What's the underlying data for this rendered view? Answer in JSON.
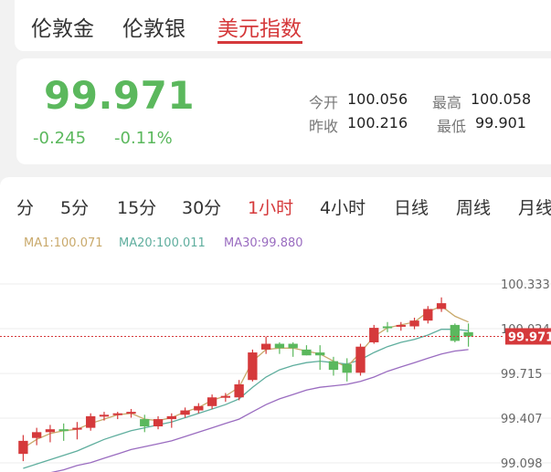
{
  "top_tabs": [
    {
      "label": "伦敦金",
      "active": false
    },
    {
      "label": "伦敦银",
      "active": false
    },
    {
      "label": "美元指数",
      "active": true
    }
  ],
  "quote": {
    "price": "99.971",
    "change": "-0.245",
    "change_pct": "-0.11%",
    "open_label": "今开",
    "open": "100.056",
    "prev_close_label": "昨收",
    "prev_close": "100.216",
    "high_label": "最高",
    "high": "100.058",
    "low_label": "最低",
    "low": "99.901",
    "up_color": "#d5393b",
    "down_color": "#5bb85d"
  },
  "periods": [
    {
      "label": "分",
      "active": false
    },
    {
      "label": "5分",
      "active": false
    },
    {
      "label": "15分",
      "active": false
    },
    {
      "label": "30分",
      "active": false
    },
    {
      "label": "1小时",
      "active": true
    },
    {
      "label": "4小时",
      "active": false
    },
    {
      "label": "日线",
      "active": false
    },
    {
      "label": "周线",
      "active": false
    },
    {
      "label": "月线",
      "active": false
    }
  ],
  "ma_legend": [
    {
      "label": "MA1:100.071",
      "color": "#c9a96b"
    },
    {
      "label": "MA20:100.011",
      "color": "#5fae9e"
    },
    {
      "label": "MA30:99.880",
      "color": "#9a6cc0"
    }
  ],
  "chart_data": {
    "type": "candlestick",
    "y_ticks": [
      "100.333",
      "100.024",
      "99.715",
      "99.407",
      "99.098"
    ],
    "ylim": [
      99.098,
      100.333
    ],
    "last_price_label": "99.971",
    "last_price": 99.971,
    "candles": [
      {
        "o": 99.16,
        "h": 99.29,
        "l": 99.11,
        "c": 99.25
      },
      {
        "o": 99.27,
        "h": 99.34,
        "l": 99.22,
        "c": 99.31
      },
      {
        "o": 99.31,
        "h": 99.36,
        "l": 99.24,
        "c": 99.33
      },
      {
        "o": 99.33,
        "h": 99.37,
        "l": 99.25,
        "c": 99.32
      },
      {
        "o": 99.33,
        "h": 99.38,
        "l": 99.26,
        "c": 99.34
      },
      {
        "o": 99.34,
        "h": 99.44,
        "l": 99.32,
        "c": 99.42
      },
      {
        "o": 99.42,
        "h": 99.45,
        "l": 99.39,
        "c": 99.43
      },
      {
        "o": 99.43,
        "h": 99.45,
        "l": 99.4,
        "c": 99.44
      },
      {
        "o": 99.44,
        "h": 99.47,
        "l": 99.41,
        "c": 99.45
      },
      {
        "o": 99.4,
        "h": 99.43,
        "l": 99.31,
        "c": 99.35
      },
      {
        "o": 99.35,
        "h": 99.42,
        "l": 99.33,
        "c": 99.4
      },
      {
        "o": 99.4,
        "h": 99.44,
        "l": 99.34,
        "c": 99.42
      },
      {
        "o": 99.43,
        "h": 99.48,
        "l": 99.41,
        "c": 99.46
      },
      {
        "o": 99.46,
        "h": 99.51,
        "l": 99.44,
        "c": 99.49
      },
      {
        "o": 99.49,
        "h": 99.57,
        "l": 99.47,
        "c": 99.55
      },
      {
        "o": 99.55,
        "h": 99.58,
        "l": 99.52,
        "c": 99.56
      },
      {
        "o": 99.55,
        "h": 99.67,
        "l": 99.53,
        "c": 99.64
      },
      {
        "o": 99.67,
        "h": 99.88,
        "l": 99.66,
        "c": 99.86
      },
      {
        "o": 99.88,
        "h": 99.97,
        "l": 99.85,
        "c": 99.92
      },
      {
        "o": 99.92,
        "h": 99.93,
        "l": 99.85,
        "c": 99.89
      },
      {
        "o": 99.92,
        "h": 99.93,
        "l": 99.83,
        "c": 99.89
      },
      {
        "o": 99.88,
        "h": 99.91,
        "l": 99.84,
        "c": 99.84
      },
      {
        "o": 99.86,
        "h": 99.91,
        "l": 99.74,
        "c": 99.84
      },
      {
        "o": 99.8,
        "h": 99.83,
        "l": 99.7,
        "c": 99.74
      },
      {
        "o": 99.78,
        "h": 99.82,
        "l": 99.66,
        "c": 99.72
      },
      {
        "o": 99.72,
        "h": 99.92,
        "l": 99.7,
        "c": 99.9
      },
      {
        "o": 99.93,
        "h": 100.05,
        "l": 99.92,
        "c": 100.03
      },
      {
        "o": 100.04,
        "h": 100.07,
        "l": 100.0,
        "c": 100.03
      },
      {
        "o": 100.05,
        "h": 100.07,
        "l": 100.01,
        "c": 100.05
      },
      {
        "o": 100.04,
        "h": 100.1,
        "l": 100.02,
        "c": 100.08
      },
      {
        "o": 100.08,
        "h": 100.18,
        "l": 100.06,
        "c": 100.16
      },
      {
        "o": 100.16,
        "h": 100.24,
        "l": 100.14,
        "c": 100.2
      },
      {
        "o": 100.05,
        "h": 100.06,
        "l": 99.93,
        "c": 99.94
      },
      {
        "o": 100.0,
        "h": 100.06,
        "l": 99.9,
        "c": 99.97
      }
    ],
    "ma1": [
      99.2,
      99.26,
      99.3,
      99.32,
      99.33,
      99.37,
      99.4,
      99.43,
      99.44,
      99.4,
      99.39,
      99.41,
      99.45,
      99.48,
      99.53,
      99.56,
      99.62,
      99.8,
      99.88,
      99.89,
      99.89,
      99.87,
      99.85,
      99.8,
      99.76,
      99.86,
      99.97,
      100.03,
      100.05,
      100.07,
      100.14,
      100.18,
      100.11,
      100.07
    ],
    "ma20": [
      99.06,
      99.09,
      99.12,
      99.15,
      99.18,
      99.22,
      99.26,
      99.29,
      99.32,
      99.34,
      99.36,
      99.38,
      99.41,
      99.44,
      99.47,
      99.5,
      99.54,
      99.62,
      99.69,
      99.74,
      99.77,
      99.79,
      99.8,
      99.79,
      99.78,
      99.81,
      99.86,
      99.9,
      99.93,
      99.95,
      99.98,
      100.02,
      100.02,
      100.01
    ],
    "ma30": [
      98.98,
      99.0,
      99.03,
      99.05,
      99.08,
      99.1,
      99.13,
      99.16,
      99.19,
      99.21,
      99.23,
      99.25,
      99.28,
      99.31,
      99.34,
      99.37,
      99.4,
      99.45,
      99.5,
      99.54,
      99.57,
      99.6,
      99.62,
      99.63,
      99.64,
      99.66,
      99.69,
      99.73,
      99.76,
      99.79,
      99.82,
      99.85,
      99.87,
      99.88
    ]
  }
}
